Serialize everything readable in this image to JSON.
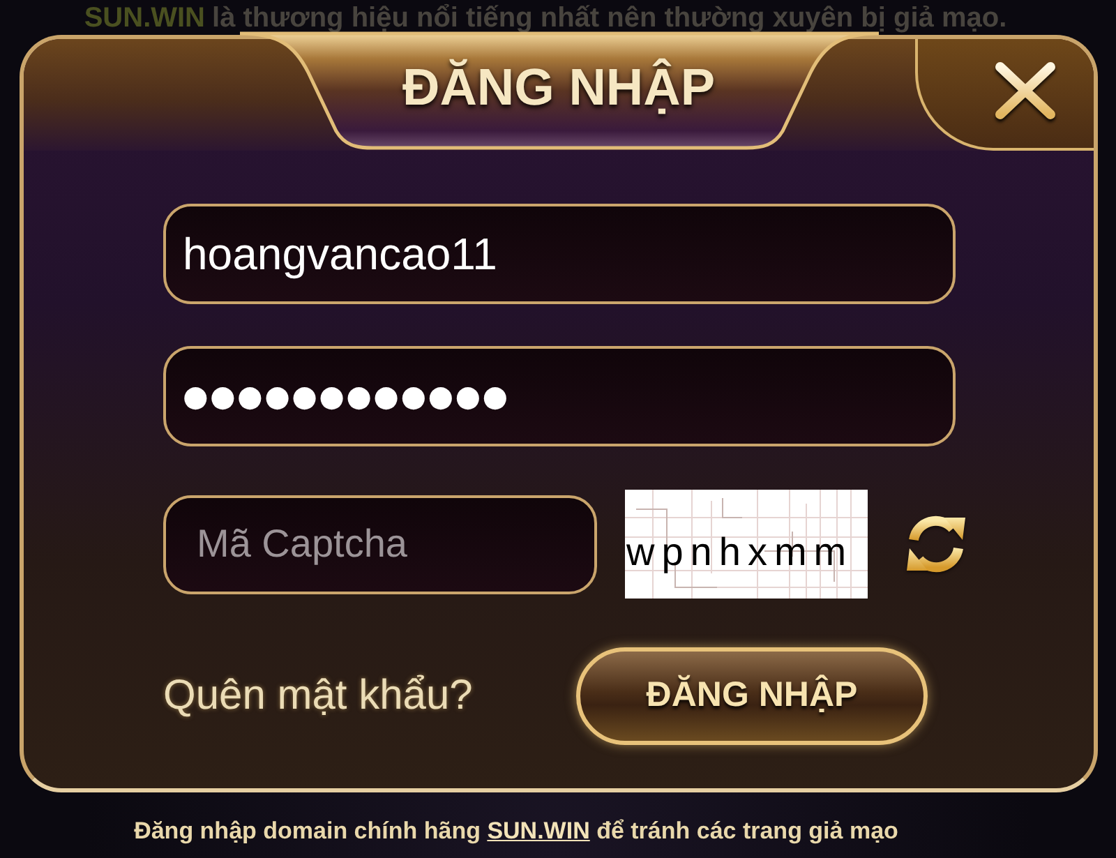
{
  "notice": {
    "brand": "SUN.WIN",
    "text": "là thương hiệu nổi tiếng nhất nên thường xuyên bị giả mạo."
  },
  "dialog": {
    "title": "ĐĂNG NHẬP"
  },
  "form": {
    "username": {
      "value": "hoangvancao11"
    },
    "password": {
      "value": "●●●●●●●●●●●●"
    },
    "captcha": {
      "placeholder": "Mã Captcha"
    },
    "captcha_image": {
      "text": "wpnhxmm"
    },
    "forgot_link": "Quên mật khẩu?",
    "submit_button": "ĐĂNG NHẬP"
  },
  "footer": {
    "text_before": "Đăng nhập domain chính hãng",
    "link": "SUN.WIN",
    "text_after": "để tránh các trang giả mạo"
  }
}
